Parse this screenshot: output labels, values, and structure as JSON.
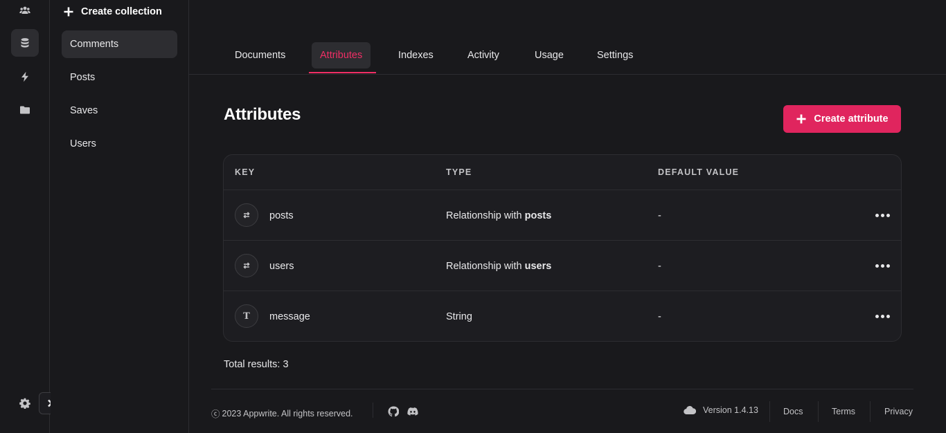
{
  "rail": {
    "items": [
      {
        "icon": "users-icon"
      },
      {
        "icon": "database-icon"
      },
      {
        "icon": "lightning-icon"
      },
      {
        "icon": "folder-icon"
      }
    ],
    "settings_icon": "gear-icon",
    "expand_icon": "chevron-right-icon"
  },
  "sidebar": {
    "create_label": "Create collection",
    "collections": [
      "Comments",
      "Posts",
      "Saves",
      "Users"
    ],
    "active": "Comments"
  },
  "tabs": {
    "items": [
      "Documents",
      "Attributes",
      "Indexes",
      "Activity",
      "Usage",
      "Settings"
    ],
    "active": "Attributes"
  },
  "main": {
    "title": "Attributes",
    "create_button_label": "Create attribute",
    "table": {
      "columns": [
        "KEY",
        "TYPE",
        "DEFAULT VALUE"
      ],
      "rows": [
        {
          "icon": "relationship-icon",
          "key": "posts",
          "type_prefix": "Relationship with",
          "type_bold": "posts",
          "default": "-"
        },
        {
          "icon": "relationship-icon",
          "key": "users",
          "type_prefix": "Relationship with",
          "type_bold": "users",
          "default": "-"
        },
        {
          "icon": "text-icon",
          "icon_glyph": "T",
          "key": "message",
          "type_prefix": "String",
          "type_bold": "",
          "default": "-"
        }
      ]
    },
    "total_label": "Total results:",
    "total_value": "3"
  },
  "footer": {
    "copyright_symbol": "ⓒ",
    "copyright": "2023 Appwrite. All rights reserved.",
    "version": "Version 1.4.13",
    "links": [
      "Docs",
      "Terms",
      "Privacy"
    ]
  },
  "colors": {
    "accent": "#f02e65",
    "button": "#e0255e",
    "background": "#19191c",
    "panel": "#1d1d21"
  }
}
